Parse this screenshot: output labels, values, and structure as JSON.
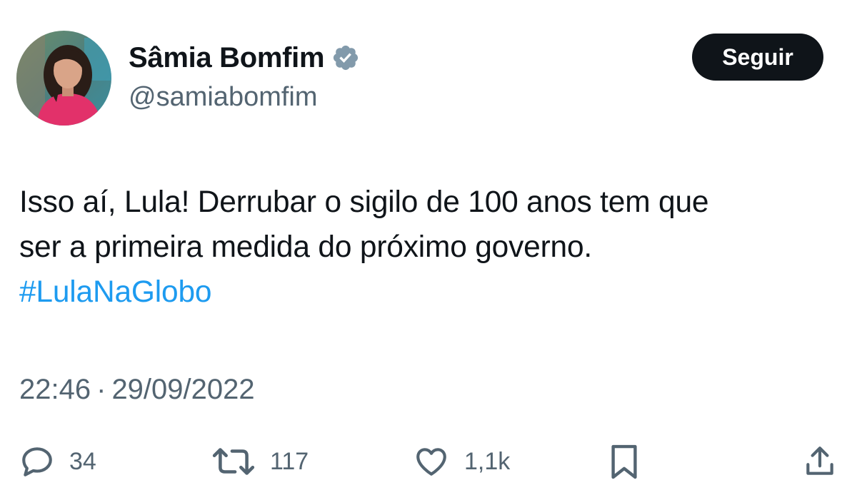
{
  "author": {
    "display_name": "Sâmia Bomfim",
    "handle": "@samiabomfim",
    "verified_icon": "verified-badge-icon"
  },
  "follow_button": {
    "label": "Seguir"
  },
  "tweet": {
    "text_line_1": "Isso aí, Lula! Derrubar o sigilo de 100 anos tem que",
    "text_line_2": "ser a primeira medida do próximo governo.",
    "hashtag": "#LulaNaGlobo"
  },
  "meta": {
    "time": "22:46",
    "separator": "·",
    "date": "29/09/2022"
  },
  "actions": {
    "reply": {
      "icon": "reply-icon",
      "count": "34"
    },
    "retweet": {
      "icon": "retweet-icon",
      "count": "117"
    },
    "like": {
      "icon": "heart-icon",
      "count": "1,1k"
    },
    "bookmark": {
      "icon": "bookmark-icon"
    },
    "share": {
      "icon": "share-icon"
    }
  },
  "colors": {
    "text": "#0f1419",
    "secondary": "#536471",
    "link": "#1d9bf0",
    "verified": "#829aab",
    "button_bg": "#0f1419"
  }
}
